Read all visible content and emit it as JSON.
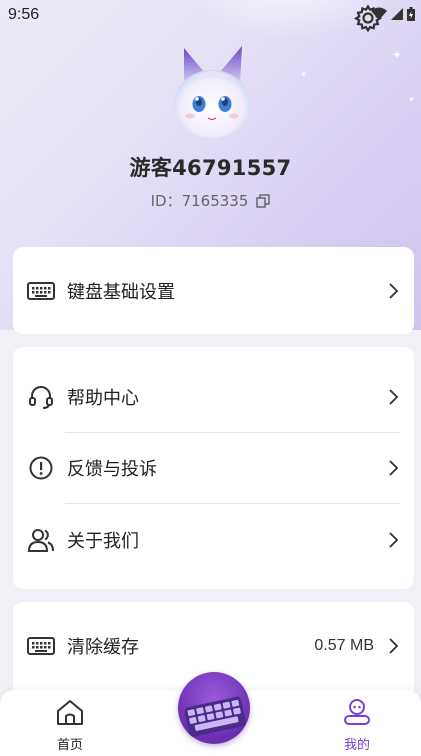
{
  "status_bar": {
    "time": "9:56"
  },
  "profile": {
    "username": "游客46791557",
    "id_label": "ID：7165335"
  },
  "menu": {
    "keyboard_settings": "键盘基础设置",
    "help_center": "帮助中心",
    "feedback": "反馈与投诉",
    "about_us": "关于我们",
    "clear_cache": "清除缓存",
    "cache_size": "0.57 MB"
  },
  "bottom_nav": {
    "home": "首页",
    "mine": "我的"
  },
  "colors": {
    "accent": "#7b3fd6",
    "text": "#222222"
  }
}
